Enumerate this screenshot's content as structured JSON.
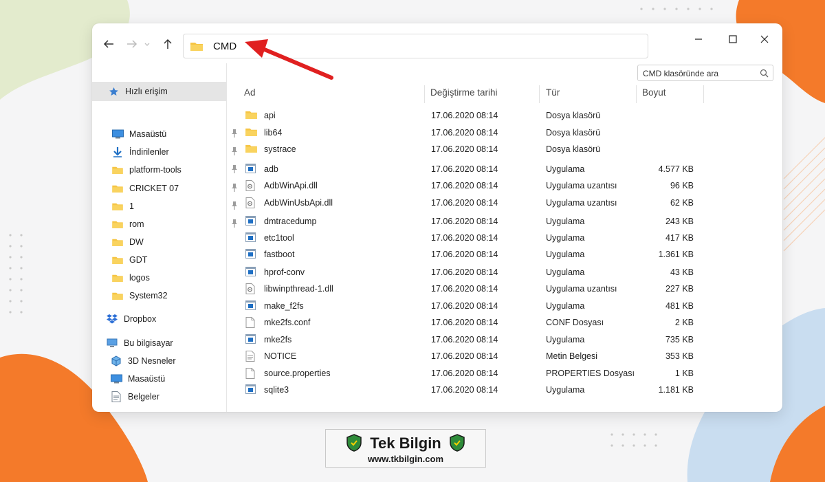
{
  "address_bar": {
    "path": "CMD"
  },
  "search": {
    "placeholder": "CMD klasöründe ara"
  },
  "sidebar": {
    "quick_access": "Hızlı erişim",
    "pinned": [
      {
        "label": "Masaüstü",
        "icon": "desktop-icon"
      },
      {
        "label": "İndirilenler",
        "icon": "download-icon"
      },
      {
        "label": "platform-tools",
        "icon": "folder-icon"
      },
      {
        "label": "CRICKET 07",
        "icon": "folder-icon"
      },
      {
        "label": "1",
        "icon": "folder-icon"
      },
      {
        "label": "rom",
        "icon": "folder-icon"
      }
    ],
    "recent": [
      {
        "label": "DW",
        "icon": "folder-icon"
      },
      {
        "label": "GDT",
        "icon": "folder-icon"
      },
      {
        "label": "logos",
        "icon": "folder-icon"
      },
      {
        "label": "System32",
        "icon": "folder-icon"
      }
    ],
    "dropbox": "Dropbox",
    "this_pc": "Bu bilgisayar",
    "pc_items": [
      {
        "label": "3D Nesneler",
        "icon": "3d-objects-icon"
      },
      {
        "label": "Masaüstü",
        "icon": "desktop-icon"
      },
      {
        "label": "Belgeler",
        "icon": "documents-icon"
      }
    ]
  },
  "columns": {
    "name": "Ad",
    "date": "Değiştirme tarihi",
    "type": "Tür",
    "size": "Boyut"
  },
  "files": [
    {
      "name": "api",
      "date": "17.06.2020 08:14",
      "type": "Dosya klasörü",
      "size": "",
      "icon": "folder"
    },
    {
      "name": "lib64",
      "date": "17.06.2020 08:14",
      "type": "Dosya klasörü",
      "size": "",
      "icon": "folder"
    },
    {
      "name": "systrace",
      "date": "17.06.2020 08:14",
      "type": "Dosya klasörü",
      "size": "",
      "icon": "folder"
    },
    {
      "name": "adb",
      "date": "17.06.2020 08:14",
      "type": "Uygulama",
      "size": "4.577 KB",
      "icon": "exe"
    },
    {
      "name": "AdbWinApi.dll",
      "date": "17.06.2020 08:14",
      "type": "Uygulama uzantısı",
      "size": "96 KB",
      "icon": "dll"
    },
    {
      "name": "AdbWinUsbApi.dll",
      "date": "17.06.2020 08:14",
      "type": "Uygulama uzantısı",
      "size": "62 KB",
      "icon": "dll"
    },
    {
      "name": "dmtracedump",
      "date": "17.06.2020 08:14",
      "type": "Uygulama",
      "size": "243 KB",
      "icon": "exe"
    },
    {
      "name": "etc1tool",
      "date": "17.06.2020 08:14",
      "type": "Uygulama",
      "size": "417 KB",
      "icon": "exe"
    },
    {
      "name": "fastboot",
      "date": "17.06.2020 08:14",
      "type": "Uygulama",
      "size": "1.361 KB",
      "icon": "exe"
    },
    {
      "name": "hprof-conv",
      "date": "17.06.2020 08:14",
      "type": "Uygulama",
      "size": "43 KB",
      "icon": "exe"
    },
    {
      "name": "libwinpthread-1.dll",
      "date": "17.06.2020 08:14",
      "type": "Uygulama uzantısı",
      "size": "227 KB",
      "icon": "dll"
    },
    {
      "name": "make_f2fs",
      "date": "17.06.2020 08:14",
      "type": "Uygulama",
      "size": "481 KB",
      "icon": "exe"
    },
    {
      "name": "mke2fs.conf",
      "date": "17.06.2020 08:14",
      "type": "CONF Dosyası",
      "size": "2 KB",
      "icon": "file"
    },
    {
      "name": "mke2fs",
      "date": "17.06.2020 08:14",
      "type": "Uygulama",
      "size": "735 KB",
      "icon": "exe"
    },
    {
      "name": "NOTICE",
      "date": "17.06.2020 08:14",
      "type": "Metin Belgesi",
      "size": "353 KB",
      "icon": "text"
    },
    {
      "name": "source.properties",
      "date": "17.06.2020 08:14",
      "type": "PROPERTIES Dosyası",
      "size": "1 KB",
      "icon": "file"
    },
    {
      "name": "sqlite3",
      "date": "17.06.2020 08:14",
      "type": "Uygulama",
      "size": "1.181 KB",
      "icon": "exe"
    }
  ],
  "brand": {
    "name": "Tek Bilgin",
    "url": "www.tkbilgin.com"
  },
  "colors": {
    "folder": "#f6c544",
    "accent": "#1e6fc4",
    "arrow": "#e02020",
    "blob_orange": "#f47a2a",
    "blob_green": "#dfe9c8",
    "blob_blue": "#c9ddf0"
  }
}
